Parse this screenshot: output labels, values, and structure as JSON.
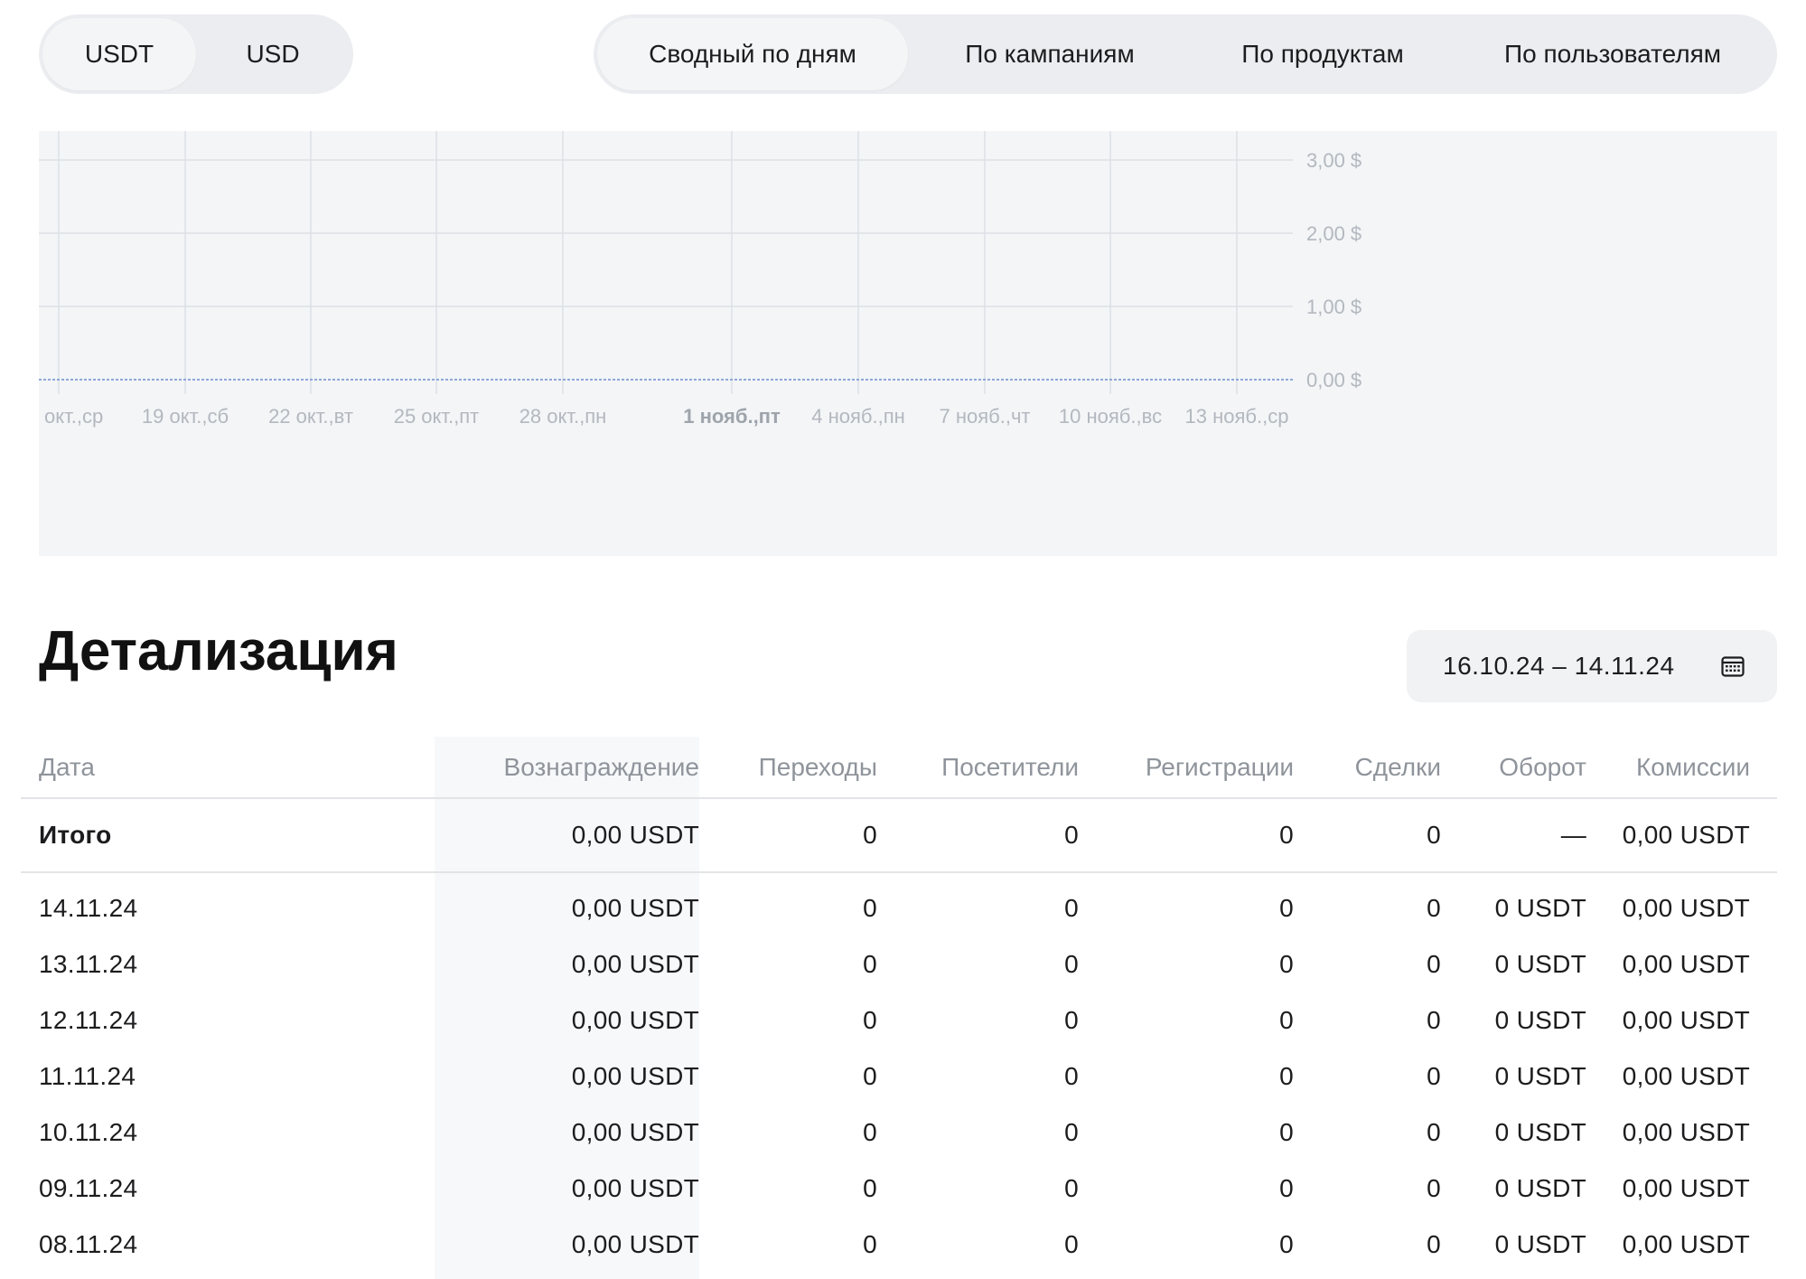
{
  "currency_toggle": {
    "options": [
      "USDT",
      "USD"
    ],
    "active": 0
  },
  "view_tabs": {
    "options": [
      "Сводный по дням",
      "По кампаниям",
      "По продуктам",
      "По пользователям"
    ],
    "active": 0
  },
  "chart_data": {
    "type": "line",
    "x": [
      "окт.,ср",
      "19 окт.,сб",
      "22 окт.,вт",
      "25 окт.,пт",
      "28 окт.,пн",
      "1 нояб.,пт",
      "4 нояб.,пн",
      "7 нояб.,чт",
      "10 нояб.,вс",
      "13 нояб.,ср"
    ],
    "x_bold": [
      "1 нояб.,пт"
    ],
    "series": [
      {
        "values": [
          0,
          0,
          0,
          0,
          0,
          0,
          0,
          0,
          0,
          0
        ]
      }
    ],
    "y_ticks": [
      "0,00 $",
      "1,00 $",
      "2,00 $",
      "3,00 $"
    ],
    "ylim": [
      0,
      3.8
    ],
    "grid": true,
    "line_color": "#8fa6d8",
    "background": "#f3f5f7"
  },
  "details": {
    "title": "Детализация",
    "date_range": "16.10.24 – 14.11.24",
    "columns": [
      "Дата",
      "Вознаграждение",
      "Переходы",
      "Посетители",
      "Регистрации",
      "Сделки",
      "Оборот",
      "Комиссии"
    ],
    "total": [
      "Итого",
      "0,00 USDT",
      "0",
      "0",
      "0",
      "0",
      "—",
      "0,00 USDT"
    ],
    "rows": [
      [
        "14.11.24",
        "0,00 USDT",
        "0",
        "0",
        "0",
        "0",
        "0 USDT",
        "0,00 USDT"
      ],
      [
        "13.11.24",
        "0,00 USDT",
        "0",
        "0",
        "0",
        "0",
        "0 USDT",
        "0,00 USDT"
      ],
      [
        "12.11.24",
        "0,00 USDT",
        "0",
        "0",
        "0",
        "0",
        "0 USDT",
        "0,00 USDT"
      ],
      [
        "11.11.24",
        "0,00 USDT",
        "0",
        "0",
        "0",
        "0",
        "0 USDT",
        "0,00 USDT"
      ],
      [
        "10.11.24",
        "0,00 USDT",
        "0",
        "0",
        "0",
        "0",
        "0 USDT",
        "0,00 USDT"
      ],
      [
        "09.11.24",
        "0,00 USDT",
        "0",
        "0",
        "0",
        "0",
        "0 USDT",
        "0,00 USDT"
      ],
      [
        "08.11.24",
        "0,00 USDT",
        "0",
        "0",
        "0",
        "0",
        "0 USDT",
        "0,00 USDT"
      ]
    ]
  },
  "icons": {
    "date_range": "calendar-icon"
  }
}
